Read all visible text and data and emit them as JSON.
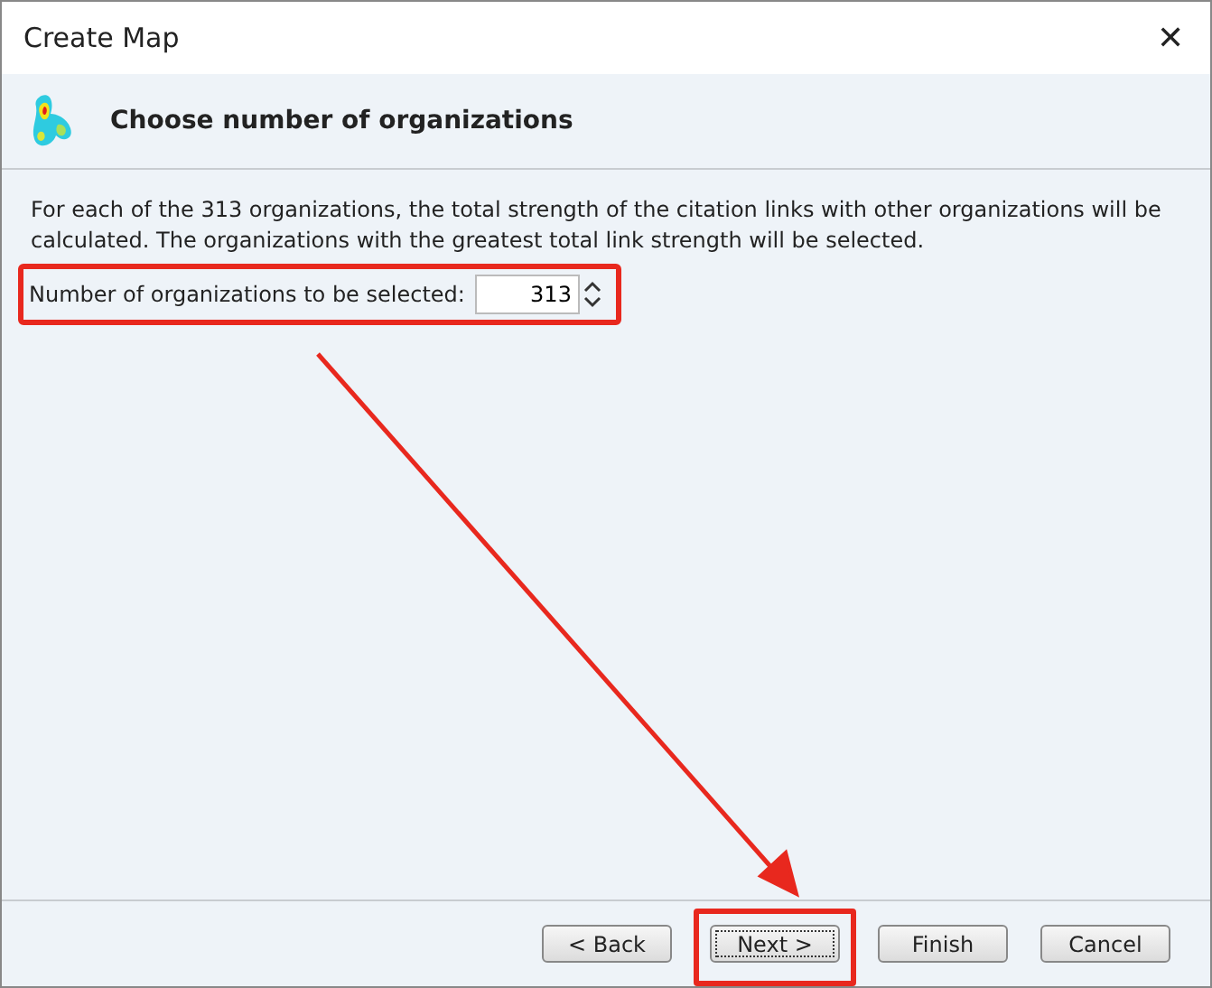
{
  "window": {
    "title": "Create Map",
    "close": "✕"
  },
  "header": {
    "title": "Choose number of organizations"
  },
  "description": "For each of the 313 organizations, the total strength of the citation links with other organizations will be calculated. The organizations with the greatest total link strength will be selected.",
  "field": {
    "label": "Number of organizations to be selected:",
    "value": "313"
  },
  "buttons": [
    {
      "label": "< Back",
      "focused": false
    },
    {
      "label": "Next >",
      "focused": true
    },
    {
      "label": "Finish",
      "focused": false
    },
    {
      "label": "Cancel",
      "focused": false
    }
  ]
}
